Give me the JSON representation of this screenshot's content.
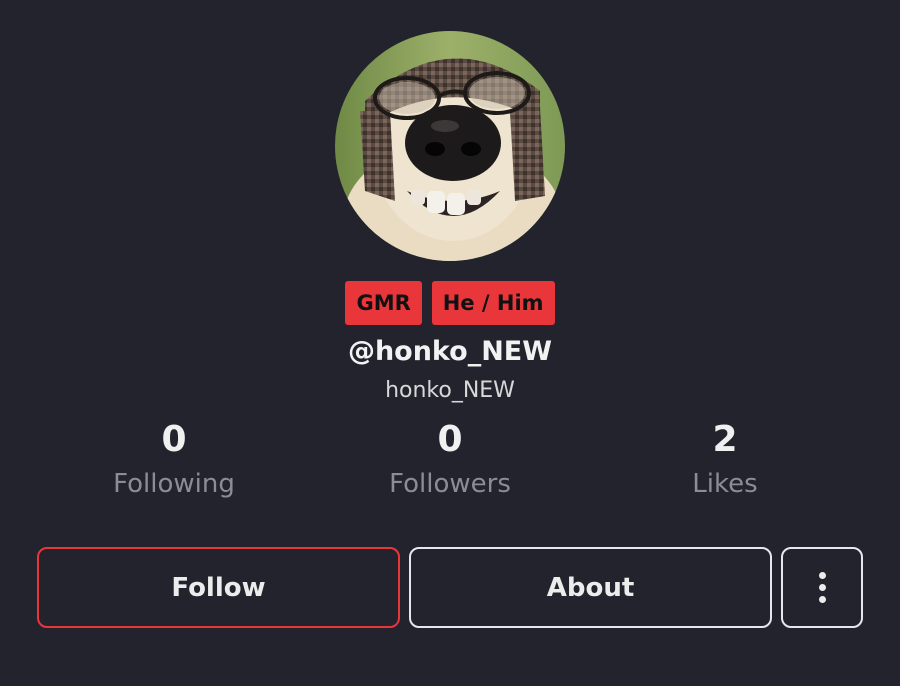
{
  "profile": {
    "badges": [
      {
        "label": "GMR"
      },
      {
        "label": "He / Him"
      }
    ],
    "handle": "@honko_NEW",
    "nickname": "honko_NEW"
  },
  "stats": [
    {
      "count": "0",
      "label": "Following"
    },
    {
      "count": "0",
      "label": "Followers"
    },
    {
      "count": "2",
      "label": "Likes"
    }
  ],
  "actions": {
    "follow_label": "Follow",
    "about_label": "About",
    "more_icon": "more-vertical-icon"
  },
  "colors": {
    "background": "#23232d",
    "badge_bg": "#e8363b",
    "follow_border": "#e8363b",
    "button_border": "#e6e6ee",
    "muted_text": "#8c8c96"
  }
}
